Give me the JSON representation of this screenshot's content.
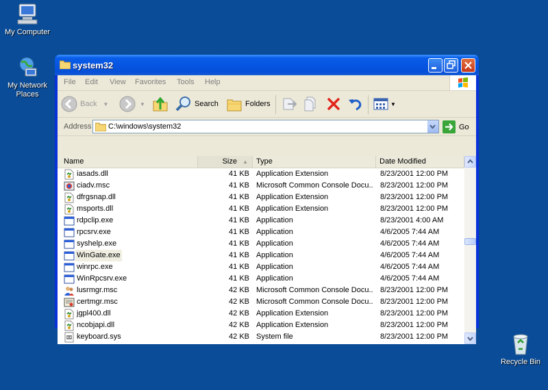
{
  "desktop": {
    "my_computer": "My Computer",
    "my_network_places": "My Network Places",
    "recycle_bin": "Recycle Bin",
    "background_color": "#0a4c98"
  },
  "window": {
    "title": "system32",
    "menu": [
      "File",
      "Edit",
      "View",
      "Favorites",
      "Tools",
      "Help"
    ],
    "toolbar": {
      "back_label": "Back",
      "search_label": "Search",
      "folders_label": "Folders"
    },
    "address": {
      "label": "Address",
      "value": "C:\\windows\\system32",
      "go_label": "Go"
    },
    "columns": {
      "name": "Name",
      "size": "Size",
      "type": "Type",
      "date": "Date Modified"
    },
    "files": [
      {
        "name": "iasads.dll",
        "size": "41 KB",
        "type": "Application Extension",
        "date": "8/23/2001 12:00 PM",
        "icon": "dll"
      },
      {
        "name": "ciadv.msc",
        "size": "41 KB",
        "type": "Microsoft Common Console Docu...",
        "date": "8/23/2001 12:00 PM",
        "icon": "msc"
      },
      {
        "name": "dfrgsnap.dll",
        "size": "41 KB",
        "type": "Application Extension",
        "date": "8/23/2001 12:00 PM",
        "icon": "dll"
      },
      {
        "name": "msports.dll",
        "size": "41 KB",
        "type": "Application Extension",
        "date": "8/23/2001 12:00 PM",
        "icon": "dll"
      },
      {
        "name": "rdpclip.exe",
        "size": "41 KB",
        "type": "Application",
        "date": "8/23/2001 4:00 AM",
        "icon": "exe"
      },
      {
        "name": "rpcsrv.exe",
        "size": "41 KB",
        "type": "Application",
        "date": "4/6/2005 7:44 AM",
        "icon": "exe"
      },
      {
        "name": "syshelp.exe",
        "size": "41 KB",
        "type": "Application",
        "date": "4/6/2005 7:44 AM",
        "icon": "exe"
      },
      {
        "name": "WinGate.exe",
        "size": "41 KB",
        "type": "Application",
        "date": "4/6/2005 7:44 AM",
        "icon": "exe",
        "selected": true
      },
      {
        "name": "winrpc.exe",
        "size": "41 KB",
        "type": "Application",
        "date": "4/6/2005 7:44 AM",
        "icon": "exe"
      },
      {
        "name": "WinRpcsrv.exe",
        "size": "41 KB",
        "type": "Application",
        "date": "4/6/2005 7:44 AM",
        "icon": "exe"
      },
      {
        "name": "lusrmgr.msc",
        "size": "42 KB",
        "type": "Microsoft Common Console Docu...",
        "date": "8/23/2001 12:00 PM",
        "icon": "msc-users"
      },
      {
        "name": "certmgr.msc",
        "size": "42 KB",
        "type": "Microsoft Common Console Docu...",
        "date": "8/23/2001 12:00 PM",
        "icon": "msc-cert"
      },
      {
        "name": "jgpl400.dll",
        "size": "42 KB",
        "type": "Application Extension",
        "date": "8/23/2001 12:00 PM",
        "icon": "dll"
      },
      {
        "name": "ncobjapi.dll",
        "size": "42 KB",
        "type": "Application Extension",
        "date": "8/23/2001 12:00 PM",
        "icon": "dll"
      },
      {
        "name": "keyboard.sys",
        "size": "42 KB",
        "type": "System file",
        "date": "8/23/2001 12:00 PM",
        "icon": "sys"
      }
    ]
  }
}
